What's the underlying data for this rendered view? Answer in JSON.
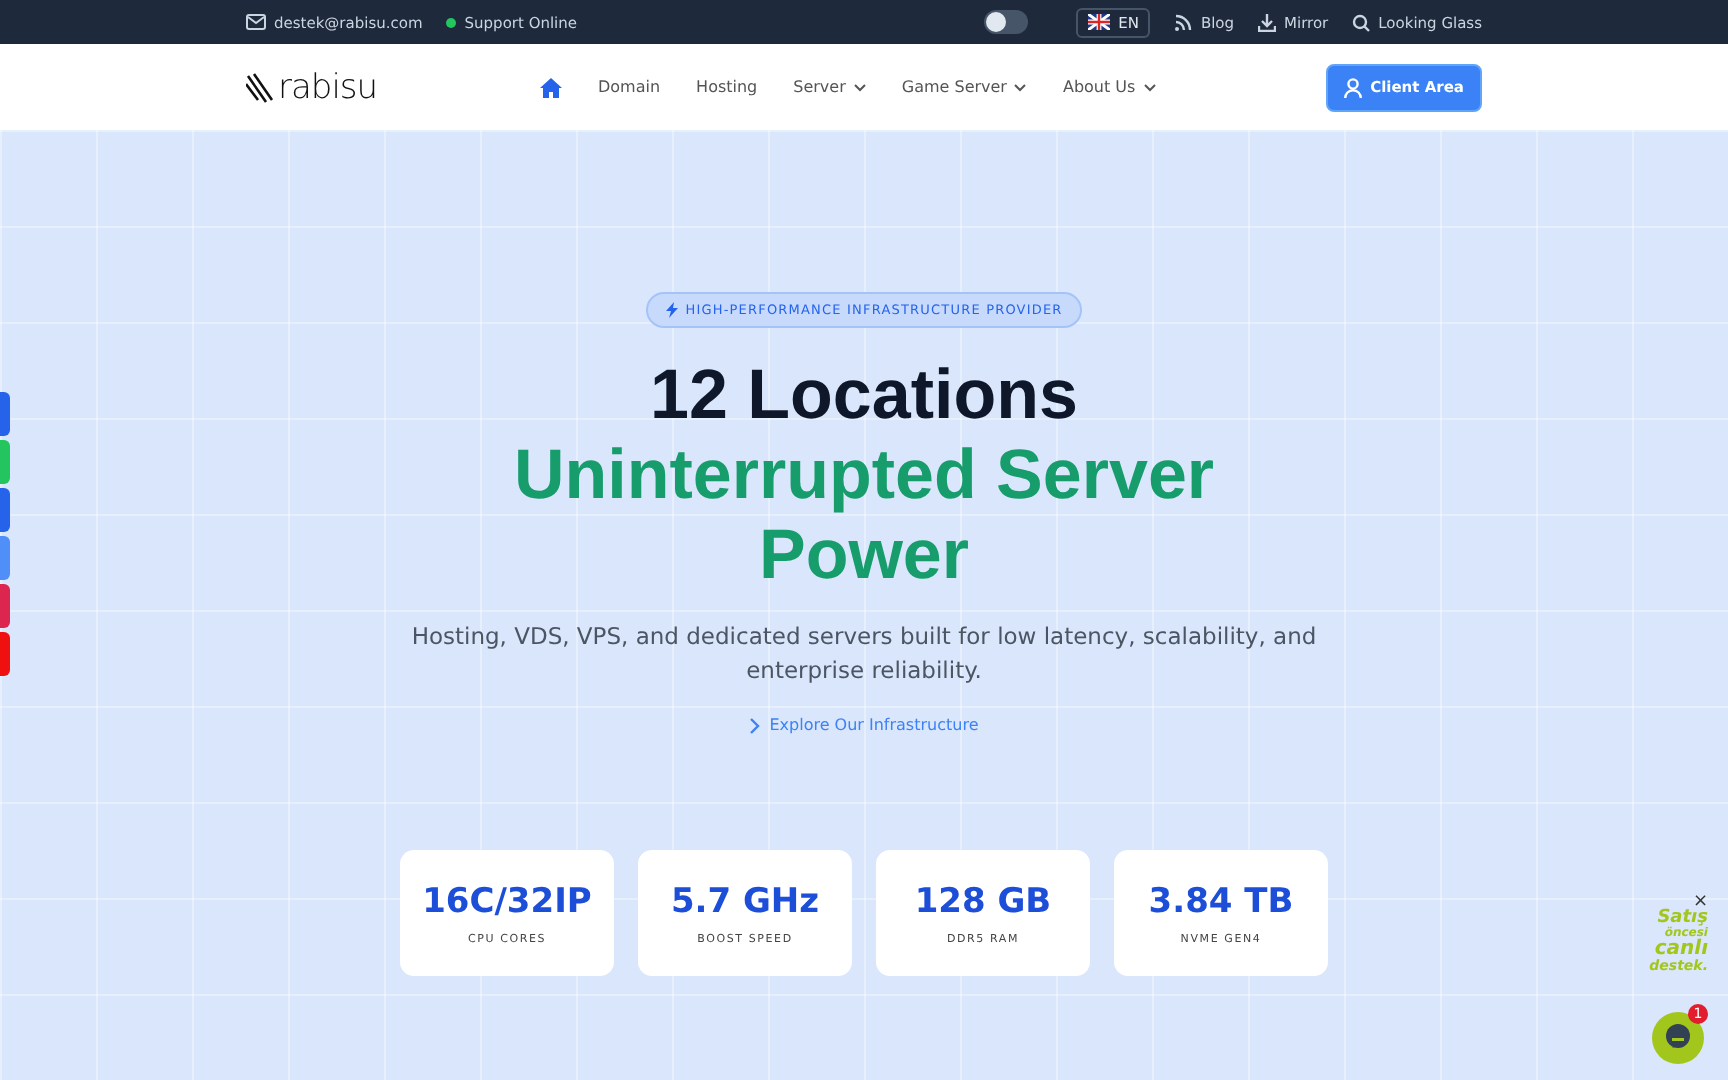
{
  "topbar": {
    "email": "destek@rabisu.com",
    "status": "Support Online",
    "theme_toggle": {
      "on": false
    },
    "language": "EN",
    "links": [
      {
        "label": "Blog"
      },
      {
        "label": "Mirror"
      },
      {
        "label": "Looking Glass"
      }
    ]
  },
  "nav": {
    "logo": "rabisu",
    "items": [
      {
        "label": "Domain",
        "dropdown": false
      },
      {
        "label": "Hosting",
        "dropdown": false
      },
      {
        "label": "Server",
        "dropdown": true
      },
      {
        "label": "Game Server",
        "dropdown": true
      },
      {
        "label": "About Us",
        "dropdown": true
      }
    ],
    "button": "Client Area"
  },
  "hero": {
    "badge": "HIGH-PERFORMANCE INFRASTRUCTURE PROVIDER",
    "title": "12 Locations",
    "highlight": "Uninterrupted Server Power",
    "description": "Hosting, VDS, VPS, and dedicated servers built for low latency, scalability, and enterprise reliability.",
    "link": "Explore Our Infrastructure",
    "stats": [
      {
        "value": "16C/32IP",
        "label": "CPU CORES"
      },
      {
        "value": "5.7 GHz",
        "label": "BOOST SPEED"
      },
      {
        "value": "128 GB",
        "label": "DDR5 RAM"
      },
      {
        "value": "3.84 TB",
        "label": "NVME GEN4"
      }
    ]
  },
  "side_tabs": [
    {
      "color": "#2563eb"
    },
    {
      "color": "#22c55e"
    },
    {
      "color": "#2563eb"
    },
    {
      "color": "#4f8ff7"
    },
    {
      "color": "#dc2650"
    },
    {
      "color": "#ef1010"
    }
  ],
  "chat": {
    "bubble": [
      "Satış",
      "öncesi",
      "canlı",
      "destek."
    ],
    "close": "×",
    "count": "1"
  }
}
